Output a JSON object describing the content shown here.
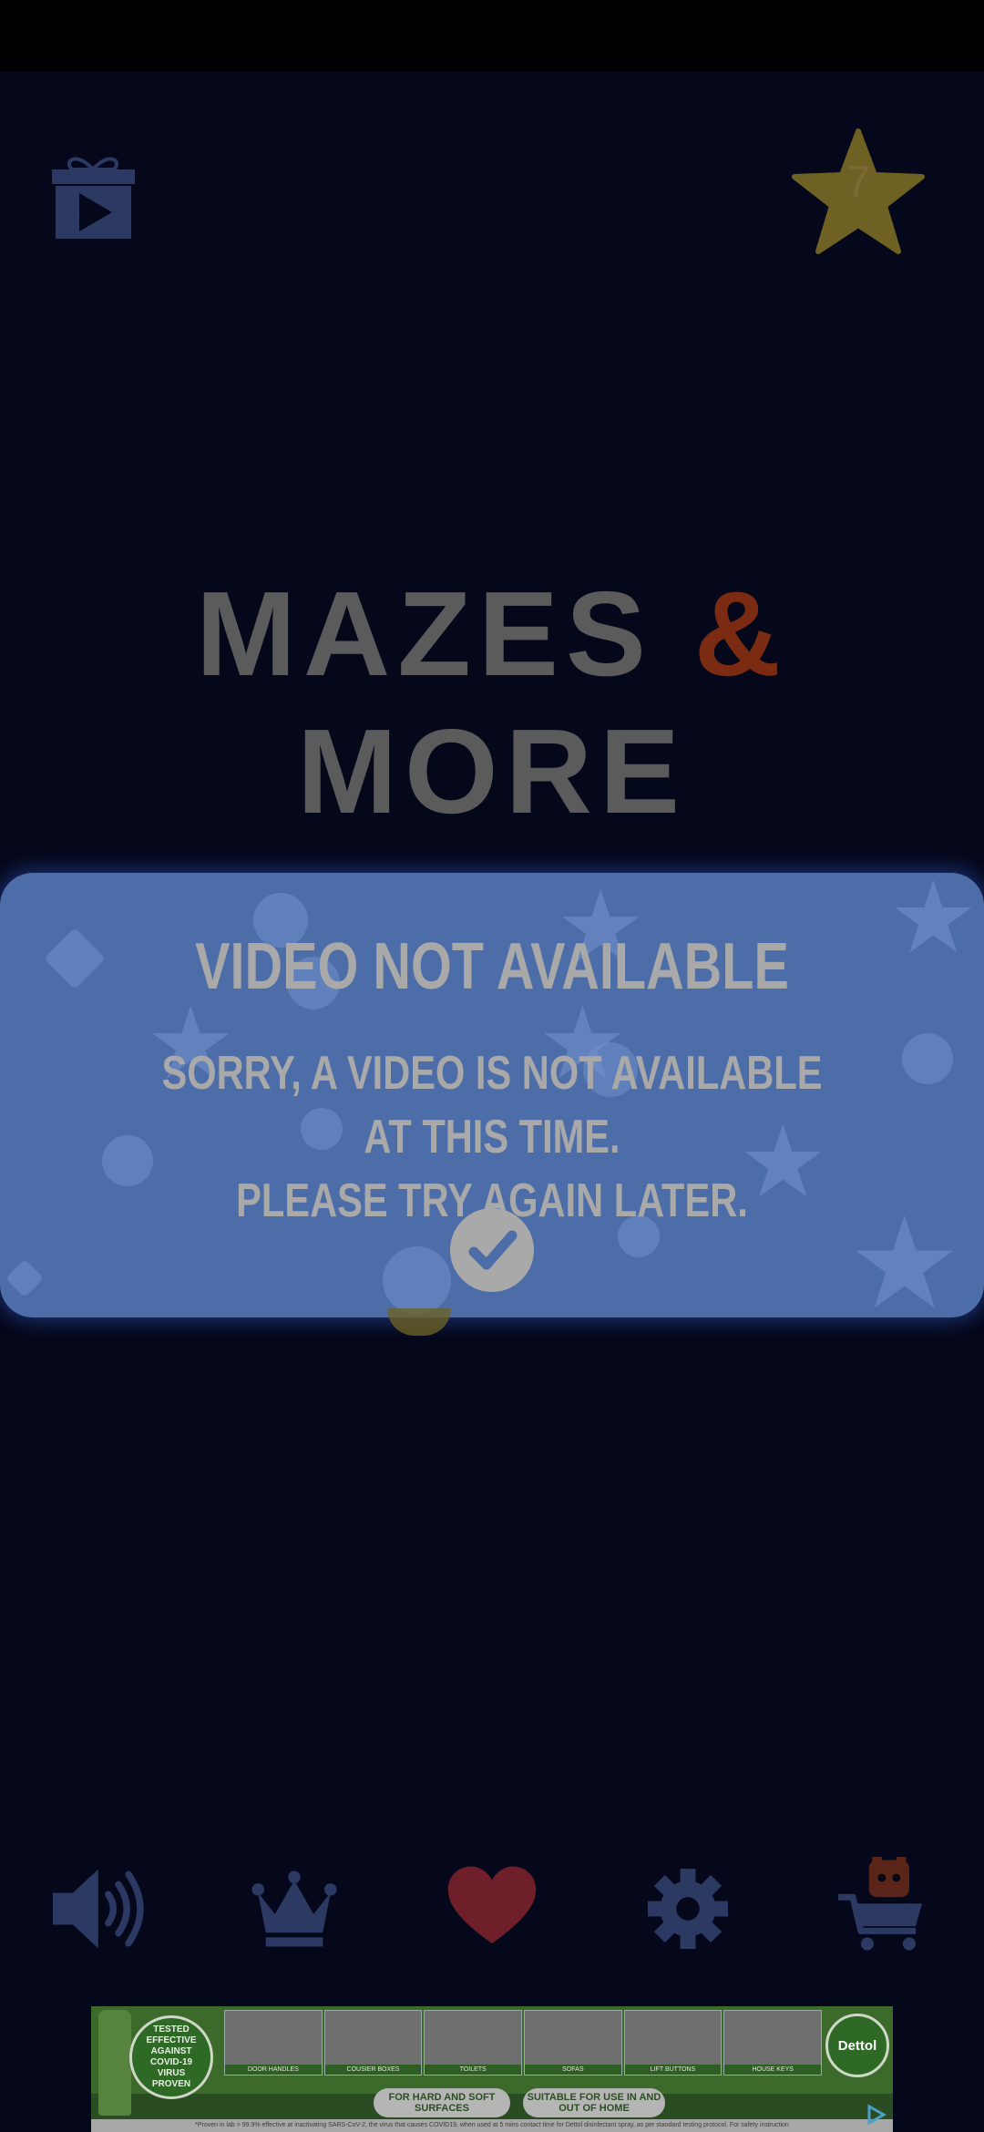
{
  "header": {
    "star_count": "7",
    "gift_icon": "gift-video-icon",
    "star_icon": "star-icon"
  },
  "game": {
    "title_left": "MAZES ",
    "title_amp": "&",
    "title_right": " MORE"
  },
  "dialog": {
    "title": "VIDEO NOT AVAILABLE",
    "message_line1": "SORRY, A VIDEO IS NOT AVAILABLE AT THIS TIME.",
    "message_line2": "PLEASE TRY AGAIN LATER.",
    "confirm_icon": "check-icon"
  },
  "nav": {
    "items": [
      {
        "name": "sound",
        "icon": "speaker-icon"
      },
      {
        "name": "leaderboard",
        "icon": "crown-icon"
      },
      {
        "name": "favorite",
        "icon": "heart-icon"
      },
      {
        "name": "settings",
        "icon": "gear-icon"
      },
      {
        "name": "shop",
        "icon": "cart-icon"
      }
    ]
  },
  "ad": {
    "seal_line1": "TESTED",
    "seal_line2": "EFFECTIVE",
    "seal_line3": "AGAINST",
    "seal_line4": "COVID-19",
    "seal_line5": "VIRUS",
    "seal_line6": "PROVEN",
    "tiles": [
      "DOOR HANDLES",
      "COUSIER BOXES",
      "TOILETS",
      "SOFAS",
      "LIFT BUTTONS",
      "HOUSE KEYS"
    ],
    "brand": "Dettol",
    "pill1": "FOR HARD AND SOFT SURFACES",
    "pill2": "SUITABLE FOR USE IN AND OUT OF HOME",
    "disclaimer": "*Proven in lab > 99.9% effective at inactivating SARS-CoV-2, the virus that causes COVID19, when used at 5 mins contact time for Dettol disinfectant spray, as per standard testing protocol. For safety instruction"
  },
  "colors": {
    "background": "#05071a",
    "dialog": "#4d6da8",
    "title_text": "#5b5b5b",
    "amp": "#7a2b12",
    "star": "#6f6124",
    "heart": "#6e1f2a",
    "icon": "#2c3a63"
  }
}
